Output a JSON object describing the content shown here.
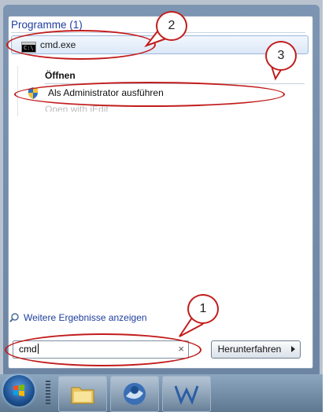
{
  "start_menu": {
    "section_header": "Programme (1)",
    "result": {
      "label": "cmd.exe",
      "icon": "cmd-console-icon"
    },
    "context": {
      "heading": "Öffnen",
      "run_as_admin": "Als Administrator ausführen",
      "open_with": "Open with jEdit"
    },
    "more_results": "Weitere Ergebnisse anzeigen",
    "search": {
      "value": "cmd"
    },
    "shutdown_label": "Herunterfahren"
  },
  "annotations": [
    "1",
    "2",
    "3"
  ],
  "colors": {
    "header_blue": "#1e3e9e",
    "callout_red": "#c21c1c",
    "highlight": "#dce8f7"
  }
}
